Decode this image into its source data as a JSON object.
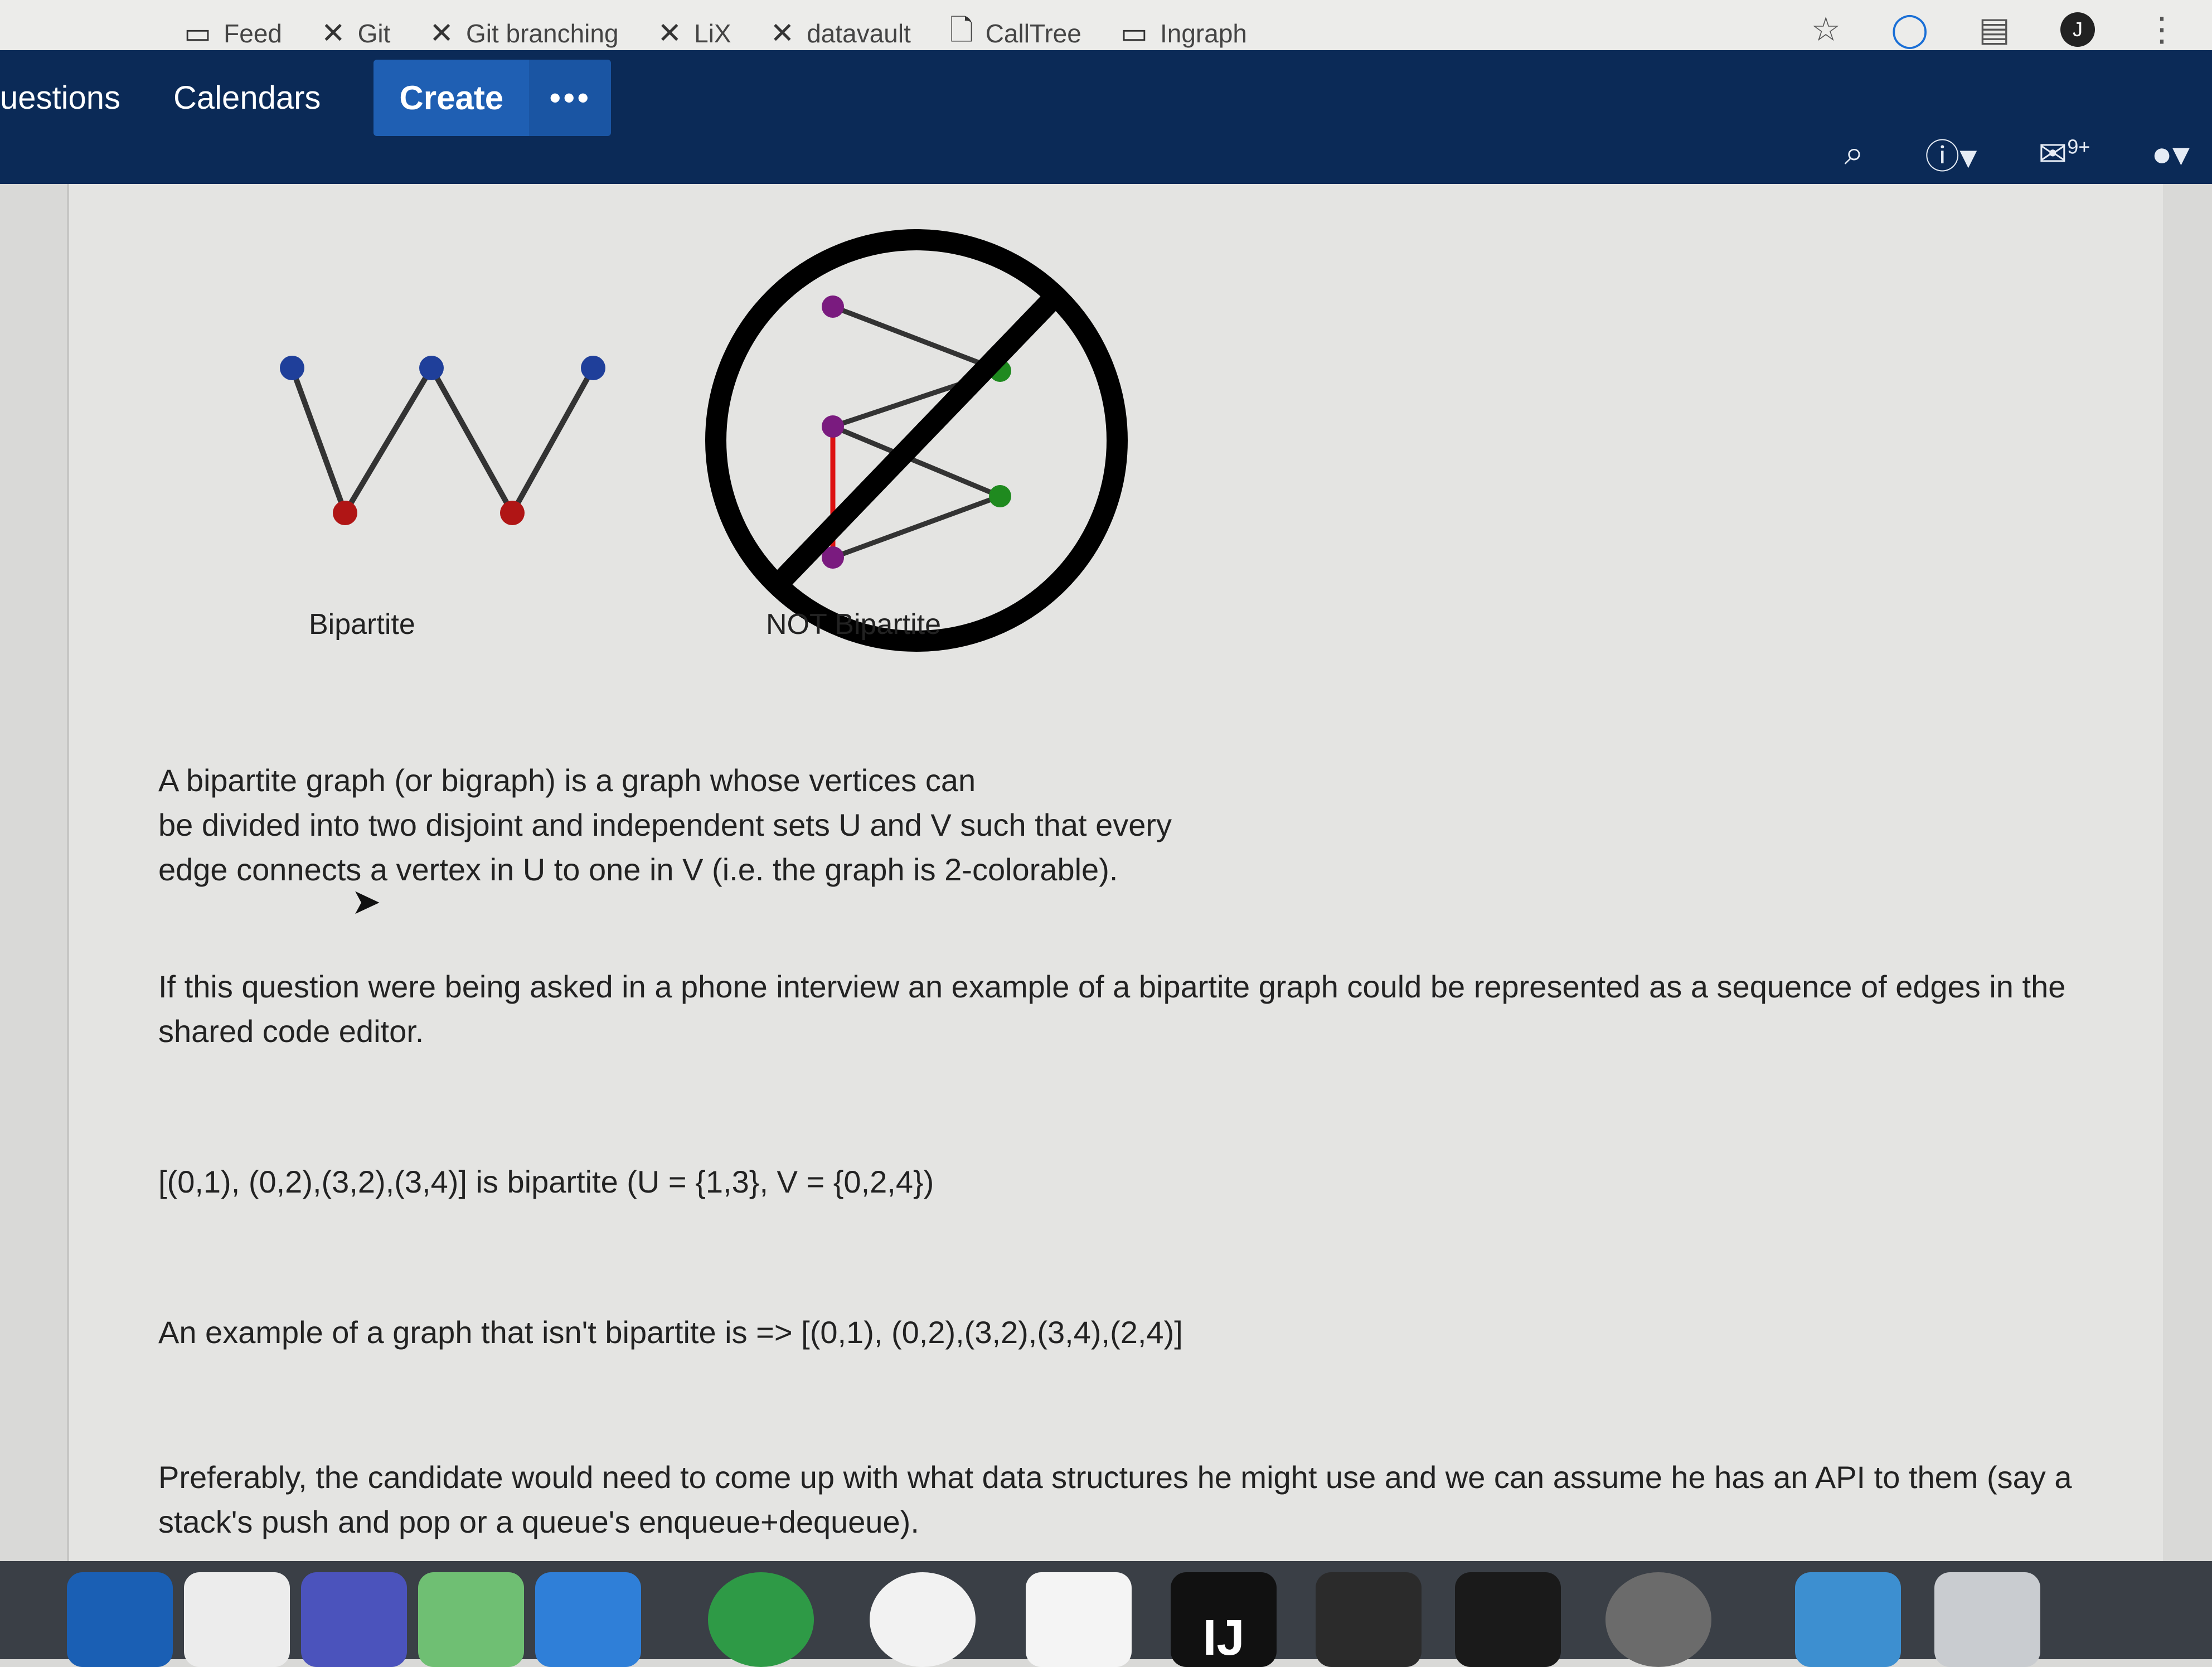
{
  "bookmarks": [
    {
      "label": "Feed",
      "icon": "box-icon"
    },
    {
      "label": "Git",
      "icon": "jira-icon"
    },
    {
      "label": "Git branching",
      "icon": "jira-icon"
    },
    {
      "label": "LiX",
      "icon": "jira-icon"
    },
    {
      "label": "datavault",
      "icon": "jira-icon"
    },
    {
      "label": "CallTree",
      "icon": "document-icon"
    },
    {
      "label": "Ingraph",
      "icon": "folder-icon"
    }
  ],
  "browser": {
    "avatar_letter": "J"
  },
  "nav": {
    "items": [
      "uestions",
      "Calendars"
    ],
    "create_label": "Create",
    "more_label": "•••",
    "notifications_badge": "9+"
  },
  "figure": {
    "left_caption": "Bipartite",
    "right_caption": "NOT Bipartite",
    "colors": {
      "blue": "#1f3f9a",
      "red": "#b01515",
      "purple": "#7a1b7f",
      "green": "#1f8a1f"
    }
  },
  "content": {
    "paragraph1_line1": "A bipartite graph (or bigraph) is a graph whose vertices can",
    "paragraph1_line2": "be divided into two disjoint and independent sets U and V such that every",
    "paragraph1_line3": "edge connects a vertex in U to one in V (i.e. the graph is 2-colorable).",
    "paragraph2": "If this question were being asked in a phone interview an example of a bipartite graph could be represented as a sequence of edges in the shared code editor.",
    "paragraph3": "[(0,1), (0,2),(3,2),(3,4)] is bipartite (U = {1,3}, V = {0,2,4})",
    "paragraph4": "An example of a graph that isn't bipartite is => [(0,1), (0,2),(3,2),(3,4),(2,4)]",
    "paragraph5": "Preferably, the candidate would need to come up with what data structures he might use and we can assume he has an API to them (say a stack's push and pop or a queue's enqueue+dequeue)."
  },
  "dock": {
    "apps": [
      "outlook-icon",
      "notes-icon",
      "teams-icon",
      "maps-icon",
      "mail-icon",
      "chrome-icon",
      "wifi-icon",
      "slack-icon",
      "intellij-icon",
      "sublime-icon",
      "terminal-icon",
      "settings-icon",
      "downloads-icon",
      "trash-icon"
    ],
    "intellij_label": "IJ"
  }
}
